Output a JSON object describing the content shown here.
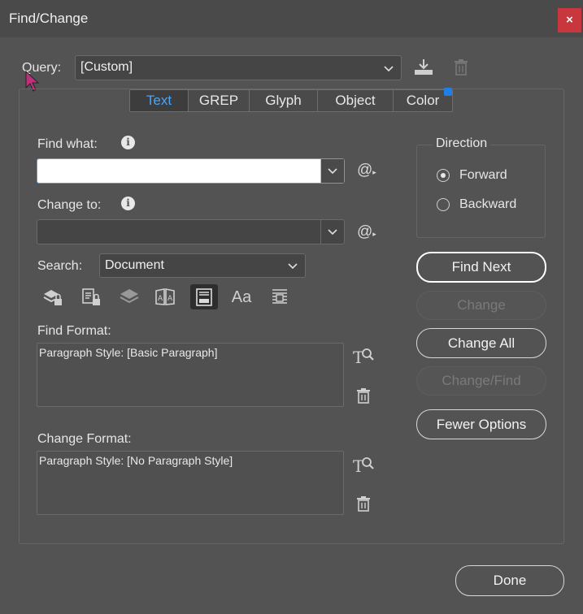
{
  "window": {
    "title": "Find/Change",
    "close_glyph": "×"
  },
  "query": {
    "label": "Query:",
    "value": "[Custom]",
    "save_icon": "save-query-icon",
    "delete_icon": "trash-icon"
  },
  "tabs": [
    {
      "label": "Text",
      "active": true
    },
    {
      "label": "GREP",
      "active": false
    },
    {
      "label": "Glyph",
      "active": false
    },
    {
      "label": "Object",
      "active": false
    },
    {
      "label": "Color",
      "active": false
    }
  ],
  "find_what": {
    "label": "Find what:",
    "value": "",
    "info_glyph": "i"
  },
  "change_to": {
    "label": "Change to:",
    "value": "",
    "info_glyph": "i"
  },
  "special_char_glyph": "@",
  "search": {
    "label": "Search:",
    "value": "Document"
  },
  "direction": {
    "label": "Direction",
    "options": [
      {
        "label": "Forward",
        "selected": true
      },
      {
        "label": "Backward",
        "selected": false
      }
    ]
  },
  "buttons": {
    "find_next": "Find Next",
    "change": "Change",
    "change_all": "Change All",
    "change_find": "Change/Find",
    "fewer_options": "Fewer Options",
    "done": "Done"
  },
  "search_options_icons": [
    "locked-layers-icon",
    "locked-stories-icon",
    "hidden-layers-icon",
    "master-pages-icon",
    "footnotes-icon",
    "case-sensitive-icon",
    "whole-word-icon"
  ],
  "case_sensitive_glyph": "Aa",
  "find_format": {
    "label": "Find Format:",
    "value": "Paragraph Style: [Basic Paragraph]"
  },
  "change_format": {
    "label": "Change Format:",
    "value": "Paragraph Style: [No Paragraph Style]"
  },
  "colors": {
    "accent": "#4ea3f5",
    "close": "#c8373d",
    "background": "#535353"
  }
}
